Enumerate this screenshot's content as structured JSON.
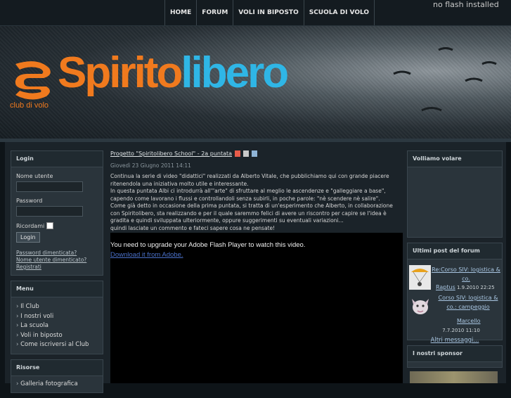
{
  "nav": {
    "items": [
      "HOME",
      "FORUM",
      "VOLI IN BIPOSTO",
      "SCUOLA DI VOLO"
    ]
  },
  "flash_note": "no flash installed",
  "banner": {
    "brand_part1": "Spirito",
    "brand_part2": "libero",
    "tagline": "club di volo"
  },
  "login": {
    "title": "Login",
    "username_label": "Nome utente",
    "password_label": "Password",
    "remember_label": "Ricordami",
    "button": "Login",
    "links": [
      "Password dimenticata?",
      "Nome utente dimenticato?",
      "Registrati"
    ]
  },
  "menu": {
    "title": "Menu",
    "items": [
      "Il Club",
      "I nostri voli",
      "La scuola",
      "Voli in biposto",
      "Come iscriversi al Club"
    ]
  },
  "risorse": {
    "title": "Risorse",
    "items": [
      "Galleria fotografica"
    ]
  },
  "article": {
    "title": "Progetto \"Spiritolibero School\" - 2a puntata",
    "date": "Giovedì 23 Giugno 2011 14:11",
    "paragraphs": [
      "Continua la serie di video \"didattici\" realizzati da Alberto Vitale, che pubblichiamo qui con grande piacere ritenendola una iniziativa molto utile e interessante.",
      "In questa puntata Albi ci introdurrà all'\"arte\" di sfruttare al meglio le ascendenze e \"galleggiare a base\", capendo come lavorano i flussi e controllandoli senza subirli, in poche parole: \"nè scendere nè salire\".",
      "Come già detto in occasione della prima puntata, si tratta di un'esperimento che Alberto, in collaborazione con Spiritolibero, sta realizzando e per il quale saremmo felici di avere un riscontro per capire se l'idea è gradita e quindi sviluppata ulteriormente, oppure suggerimenti su eventuali variazioni...",
      "quindi lasciate un commento e fateci sapere cosa ne pensate!"
    ],
    "video_message": "You need to upgrade your Adobe Flash Player to watch this video.",
    "video_link": "Download it from Adobe."
  },
  "right": {
    "volare_title": "Volliamo volare",
    "forum_title": "Ultimi post del forum",
    "posts": [
      {
        "title": "Re:Corso SIV: logistica & co.",
        "author": "Raptus",
        "date": "1.9.2010 22:25"
      },
      {
        "title": "Corso SIV: logistica & co.: campeggio",
        "author": "Marcello",
        "date": "7.7.2010 11:10"
      }
    ],
    "more": "Altri messaggi...",
    "sponsor_title": "I nostri sponsor"
  },
  "colors": {
    "orange": "#f07a1e",
    "blue": "#2fb6e6",
    "background": "#0e1418",
    "panel": "#2a343b"
  }
}
